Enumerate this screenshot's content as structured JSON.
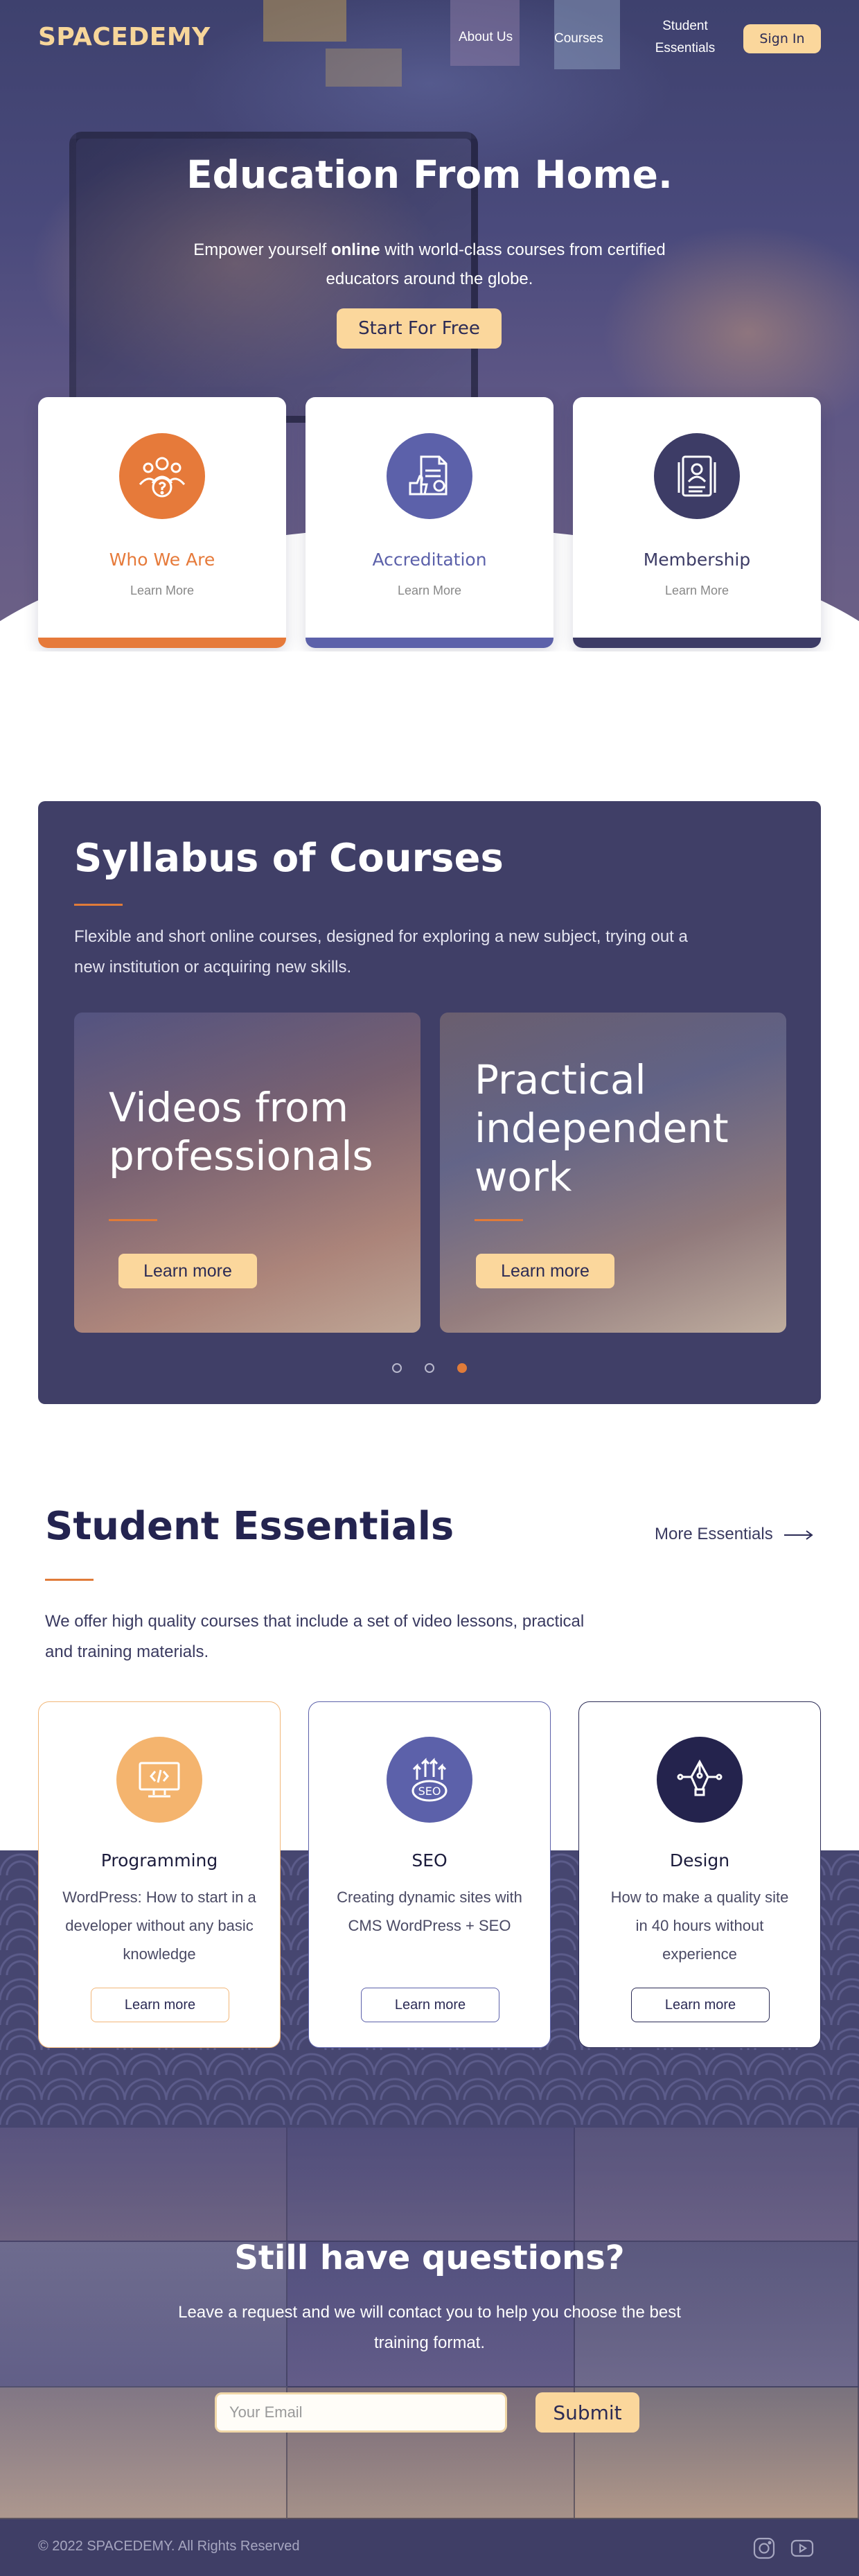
{
  "nav": {
    "logo": "SPACEDEMY",
    "about": "About Us",
    "courses": "Courses",
    "essentials_line1": "Student",
    "essentials_line2": "Essentials",
    "signin": "Sign In"
  },
  "hero": {
    "title": "Education From Home.",
    "sub_pre": "Empower yourself ",
    "sub_bold": "online",
    "sub_post": " with world-class courses from certified educators around the globe.",
    "cta": "Start For Free"
  },
  "info_cards": [
    {
      "title": "Who We Are",
      "link": "Learn More",
      "color": "#e67a3a",
      "icon": "team-question-icon"
    },
    {
      "title": "Accreditation",
      "link": "Learn More",
      "color": "#5c61aa",
      "icon": "certificate-icon"
    },
    {
      "title": "Membership",
      "link": "Learn More",
      "color": "#3d3c66",
      "icon": "member-card-icon"
    }
  ],
  "syllabus": {
    "title": "Syllabus of Courses",
    "desc": "Flexible and short online courses, designed for exploring a new subject, trying out a new institution or acquiring new skills.",
    "cards": [
      {
        "title_line1": "Videos from",
        "title_line2": "professionals",
        "button": "Learn more"
      },
      {
        "title_line1": "Practical",
        "title_line2": "independent",
        "title_line3": "work",
        "button": "Learn more"
      }
    ],
    "active_slide": 3
  },
  "essentials": {
    "title": "Student Essentials",
    "more": "More Essentials",
    "desc": "We offer high quality courses that include a set of video lessons, practical and training materials.",
    "cards": [
      {
        "title": "Programming",
        "desc": "WordPress: How to start in a developer without any basic knowledge",
        "button": "Learn more",
        "color": "#f4b46e",
        "icon": "monitor-code-icon"
      },
      {
        "title": "SEO",
        "desc": "Creating dynamic sites with CMS WordPress + SEO",
        "button": "Learn more",
        "color": "#5c61aa",
        "icon": "seo-growth-icon"
      },
      {
        "title": "Design",
        "desc": "How to make a quality site in 40 hours without experience",
        "button": "Learn more",
        "color": "#24234d",
        "icon": "pen-tool-icon"
      }
    ]
  },
  "questions": {
    "title": "Still have questions?",
    "sub": "Leave a request and we will contact you to help you choose the best training format.",
    "placeholder": "Your Email",
    "submit": "Submit"
  },
  "footer": {
    "copyright": "© 2022 SPACEDEMY. All Rights Reserved",
    "icons": [
      "instagram-icon",
      "youtube-icon"
    ]
  },
  "colors": {
    "accent": "#fbd79c",
    "orange": "#e07b39",
    "navy": "#403f67"
  }
}
